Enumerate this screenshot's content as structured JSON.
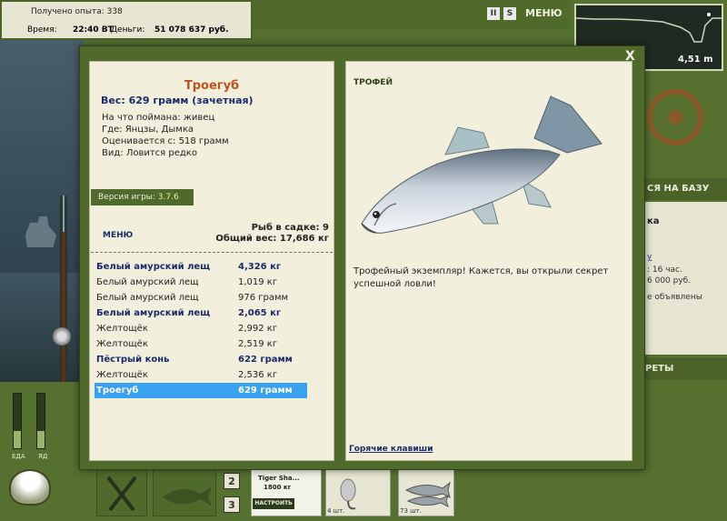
{
  "header": {
    "experience": "Получено опыта: 338",
    "time_label": "Время:",
    "time_value": "22:40 ВТ",
    "money_label": "Деньги:",
    "money_value": "51 078 637 руб.",
    "pause": "II",
    "sound": "S",
    "menu": "МЕНЮ"
  },
  "depth": {
    "value": "4,51 m"
  },
  "right_side": {
    "base_button": "СЯ НА БАЗУ",
    "line1": "ка",
    "line2": "у",
    "line3": ": 16 час.",
    "line4": "6 000 руб.",
    "line5": "е объявлены",
    "secrets_button": "РЕТЫ"
  },
  "bottom": {
    "food_label": "ЕДА",
    "energy_label": "ЯД",
    "slot_2": "2",
    "slot_3": "3",
    "rod_name": "Tiger Sha...",
    "rod_weight": "1800 кг",
    "setup_button": "НАСТРОИТЬ",
    "lure_count": "4 шт.",
    "bait_count": "73 шт."
  },
  "dialog": {
    "close": "X",
    "fish_name": "Троегуб",
    "fish_weight": "Вес: 629 грамм (зачетная)",
    "caught_on": "На что поймана: живец",
    "caught_where": "Где: Янцзы, Дымка",
    "rated_from": "Оценивается с: 518 грамм",
    "kind": "Вид: Ловится редко",
    "version_label": "Версия игры: ",
    "version_value": "3.7.6",
    "menu": "МЕНЮ",
    "keepnet_count": "Рыб в садке: 9",
    "keepnet_weight": "Общий вес: 17,686 кг",
    "catches": [
      {
        "name": "Белый амурский лещ",
        "weight": "4,326 кг",
        "style": "trophy"
      },
      {
        "name": "Белый амурский лещ",
        "weight": "1,019 кг",
        "style": "normal"
      },
      {
        "name": "Белый амурский лещ",
        "weight": "976 грамм",
        "style": "normal"
      },
      {
        "name": "Белый амурский лещ",
        "weight": "2,065 кг",
        "style": "trophy"
      },
      {
        "name": "Желтощёк",
        "weight": "2,992 кг",
        "style": "normal"
      },
      {
        "name": "Желтощёк",
        "weight": "2,519 кг",
        "style": "normal"
      },
      {
        "name": "Пёстрый конь",
        "weight": "622 грамм",
        "style": "trophy"
      },
      {
        "name": "Желтощёк",
        "weight": "2,536 кг",
        "style": "normal"
      },
      {
        "name": "Троегуб",
        "weight": "629 грамм",
        "style": "selected"
      }
    ],
    "trophy_label": "ТРОФЕЙ",
    "trophy_text": "Трофейный экземпляр! Кажется, вы открыли секрет успешной ловли!",
    "hotkeys": "Горячие клавиши"
  },
  "colors": {
    "frame_green": "#4f6a2b",
    "panel_bg": "#f2f0dc",
    "fish_name": "#c0511c",
    "trophy_blue": "#1b2a6a",
    "selected_row": "#3aa0f0"
  }
}
